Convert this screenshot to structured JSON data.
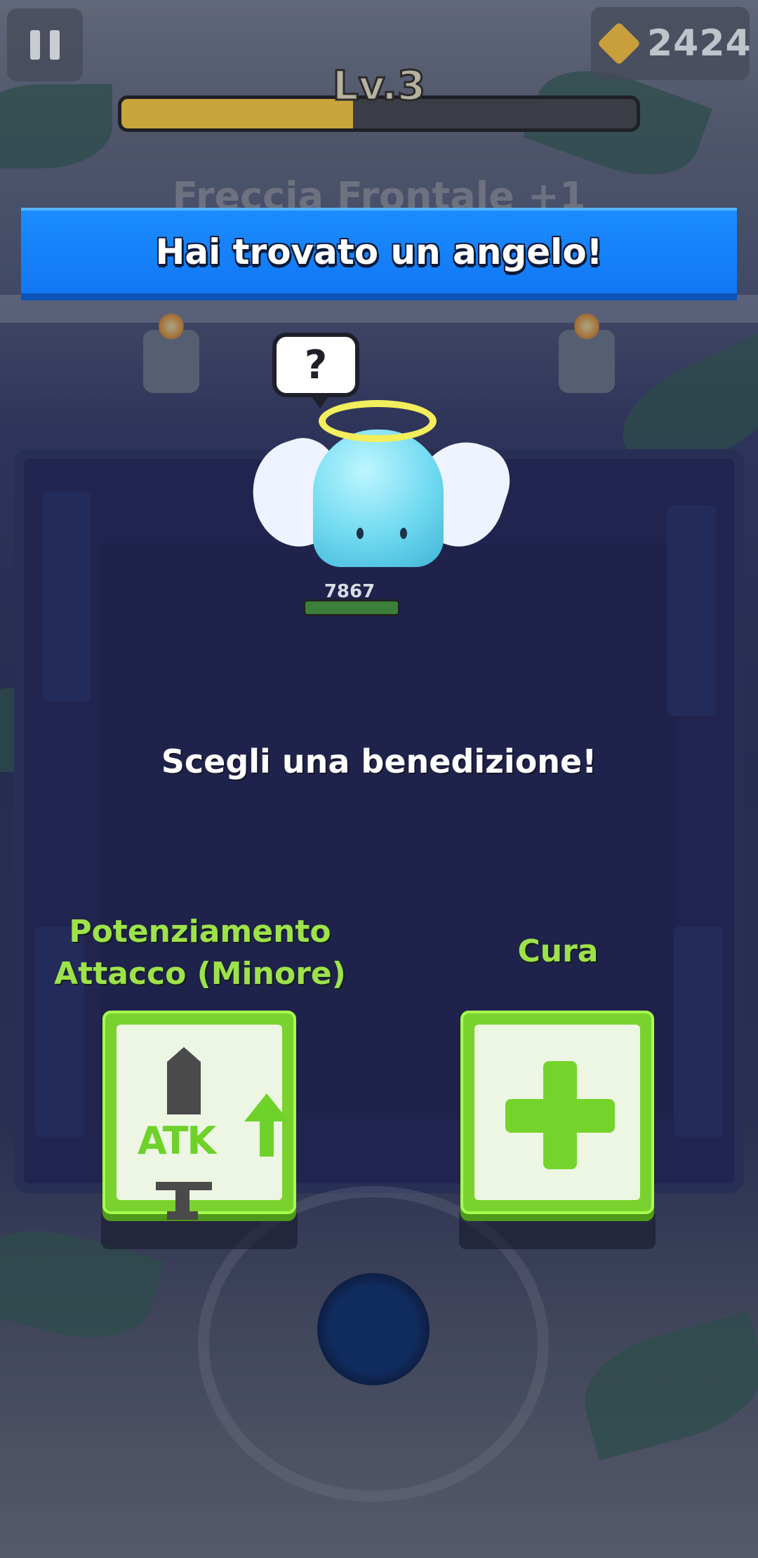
{
  "hud": {
    "gem_count": "2424",
    "level_label": "Lv.3",
    "xp_progress": 0.45,
    "skill_text": "Freccia Frontale +1"
  },
  "banner": {
    "title": "Hai trovato un angelo!"
  },
  "angel": {
    "bubble_symbol": "?",
    "icon": "angel-ghost"
  },
  "player": {
    "hp": "7867"
  },
  "blessing": {
    "prompt": "Scegli una benedizione!",
    "options": [
      {
        "label": "Potenziamento Attacco (Minore)",
        "icon_text": "ATK",
        "icon": "sword-atk-up-icon"
      },
      {
        "label": "Cura",
        "icon": "plus-icon"
      }
    ]
  },
  "colors": {
    "banner": "#1a86ff",
    "option_green": "#7ad22e",
    "label_green": "#9ee24a"
  }
}
